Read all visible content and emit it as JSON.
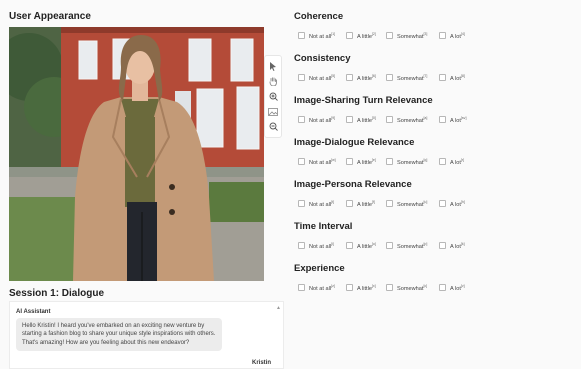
{
  "left": {
    "appearance_title": "User Appearance",
    "session_title": "Session 1: Dialogue"
  },
  "toolbar": [
    {
      "name": "cursor-icon"
    },
    {
      "name": "hand-icon"
    },
    {
      "name": "zoom-in-icon"
    },
    {
      "name": "image-icon"
    },
    {
      "name": "zoom-out-icon"
    }
  ],
  "chat": {
    "sender": "AI Assistant",
    "message": "Hello Kristin! I heard you've embarked on an exciting new venture by starting a fashion blog to share your unique style inspirations with others. That's amazing! How are you feeling about this new endeavor?",
    "next_sender": "Kristin"
  },
  "questions": [
    {
      "title": "Coherence",
      "options": [
        [
          "Not at all",
          "[1]"
        ],
        [
          "A little",
          "[2]"
        ],
        [
          "Somewhat",
          "[3]"
        ],
        [
          "A lot",
          "[4]"
        ]
      ]
    },
    {
      "title": "Consistency",
      "options": [
        [
          "Not at all",
          "[5]"
        ],
        [
          "A little",
          "[6]"
        ],
        [
          "Somewhat",
          "[7]"
        ],
        [
          "A lot",
          "[8]"
        ]
      ]
    },
    {
      "title": "Image-Sharing Turn Relevance",
      "options": [
        [
          "Not at all",
          "[9]"
        ],
        [
          "A little",
          "[0]"
        ],
        [
          "Somewhat",
          "[a]"
        ],
        [
          "A lot",
          "[sv]"
        ]
      ]
    },
    {
      "title": "Image-Dialogue Relevance",
      "options": [
        [
          "Not at all",
          "[w]"
        ],
        [
          "A little",
          "[e]"
        ],
        [
          "Somewhat",
          "[q]"
        ],
        [
          "A lot",
          "[r]"
        ]
      ]
    },
    {
      "title": "Image-Persona Relevance",
      "options": [
        [
          "Not at all",
          "[t]"
        ],
        [
          "A little",
          "[f]"
        ],
        [
          "Somewhat",
          "[u]"
        ],
        [
          "A lot",
          "[h]"
        ]
      ]
    },
    {
      "title": "Time Interval",
      "options": [
        [
          "Not at all",
          "[i]"
        ],
        [
          "A little",
          "[o]"
        ],
        [
          "Somewhat",
          "[p]"
        ],
        [
          "A lot",
          "[k]"
        ]
      ]
    },
    {
      "title": "Experience",
      "options": [
        [
          "Not at all",
          "[z]"
        ],
        [
          "A little",
          "[x]"
        ],
        [
          "Somewhat",
          "[c]"
        ],
        [
          "A lot",
          "[v]"
        ]
      ]
    }
  ]
}
